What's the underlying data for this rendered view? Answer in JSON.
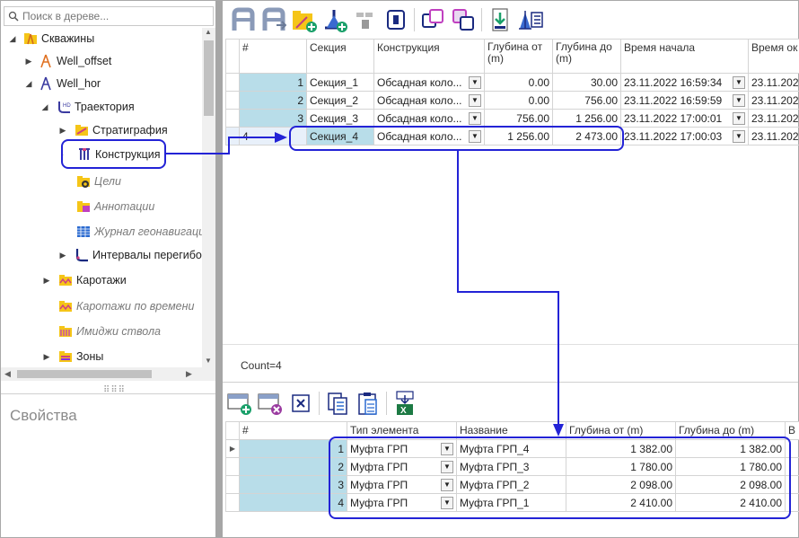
{
  "search": {
    "placeholder": "Поиск в дереве..."
  },
  "tree": {
    "nodes": [
      {
        "label": "Скважины",
        "icon": "folder-well-icon"
      },
      {
        "label": "Well_offset",
        "icon": "well-rig-icon"
      },
      {
        "label": "Well_hor",
        "icon": "well-rig-icon"
      },
      {
        "label": "Траектория",
        "icon": "trajectory-icon"
      },
      {
        "label": "Стратиграфия",
        "icon": "stratigraphy-folder-icon"
      },
      {
        "label": "Конструкция",
        "icon": "casing-icon"
      },
      {
        "label": "Цели",
        "icon": "targets-folder-icon"
      },
      {
        "label": "Аннотации",
        "icon": "annotations-folder-icon"
      },
      {
        "label": "Журнал геонавигации",
        "icon": "geosteering-log-icon"
      },
      {
        "label": "Интервалы перегибов",
        "icon": "bend-intervals-icon"
      },
      {
        "label": "Каротажи",
        "icon": "logs-folder-icon"
      },
      {
        "label": "Каротажи по времени",
        "icon": "time-logs-folder-icon"
      },
      {
        "label": "Имиджи ствола",
        "icon": "borehole-images-folder-icon"
      },
      {
        "label": "Зоны",
        "icon": "zones-folder-icon"
      }
    ]
  },
  "properties": {
    "title": "Свойства"
  },
  "top_table": {
    "headers": [
      "#",
      "Секция",
      "Конструкция",
      "Глубина от (m)",
      "Глубина до (m)",
      "Время начала",
      "Время ок"
    ],
    "rows": [
      {
        "idx": "1",
        "section": "Секция_1",
        "construction": "Обсадная коло...",
        "from": "0.00",
        "to": "30.00",
        "start": "23.11.2022 16:59:34",
        "end": "23.11.202"
      },
      {
        "idx": "2",
        "section": "Секция_2",
        "construction": "Обсадная коло...",
        "from": "0.00",
        "to": "756.00",
        "start": "23.11.2022 16:59:59",
        "end": "23.11.202"
      },
      {
        "idx": "3",
        "section": "Секция_3",
        "construction": "Обсадная коло...",
        "from": "756.00",
        "to": "1 256.00",
        "start": "23.11.2022 17:00:01",
        "end": "23.11.202"
      },
      {
        "idx": "4",
        "section": "Секция_4",
        "construction": "Обсадная коло...",
        "from": "1 256.00",
        "to": "2 473.00",
        "start": "23.11.2022 17:00:03",
        "end": "23.11.202"
      }
    ]
  },
  "count_label": "Count=4",
  "bottom_table": {
    "headers": [
      "#",
      "Тип элемента",
      "Название",
      "Глубина от (m)",
      "Глубина до (m)",
      "В"
    ],
    "rows": [
      {
        "idx": "1",
        "type": "Муфта ГРП",
        "name": "Муфта ГРП_4",
        "from": "1 382.00",
        "to": "1 382.00"
      },
      {
        "idx": "2",
        "type": "Муфта ГРП",
        "name": "Муфта ГРП_3",
        "from": "1 780.00",
        "to": "1 780.00"
      },
      {
        "idx": "3",
        "type": "Муфта ГРП",
        "name": "Муфта ГРП_2",
        "from": "2 098.00",
        "to": "2 098.00"
      },
      {
        "idx": "4",
        "type": "Муфта ГРП",
        "name": "Муфта ГРП_1",
        "from": "2 410.00",
        "to": "2 410.00"
      }
    ]
  },
  "colors": {
    "highlight": "#2323d6",
    "index_cell": "#b8dde9",
    "splitter": "#a6a6a6"
  }
}
